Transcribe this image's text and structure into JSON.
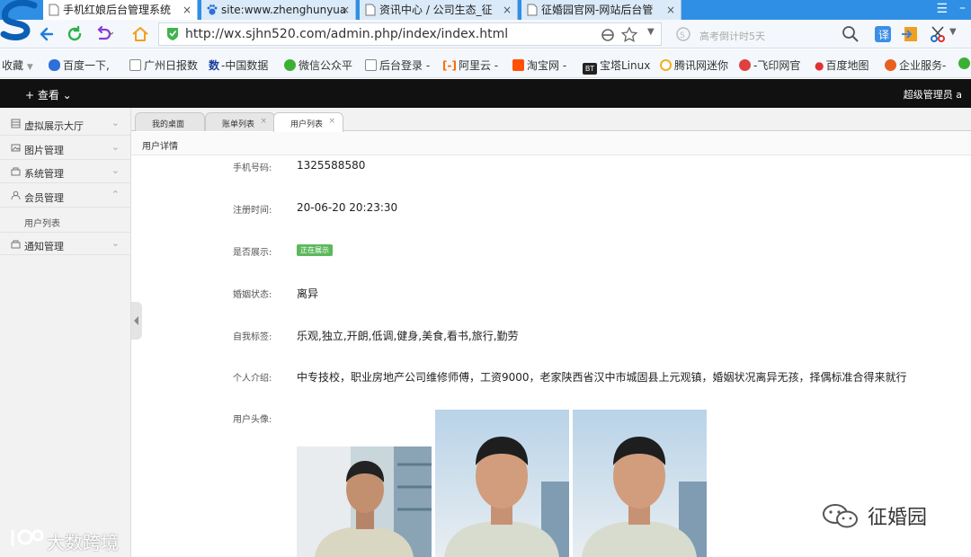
{
  "browser": {
    "tabs": [
      {
        "label": "手机红娘后台管理系统",
        "close": "×"
      },
      {
        "label": "site:www.zhenghunyua",
        "close": "×"
      },
      {
        "label": "资讯中心 / 公司生态_征",
        "close": "×"
      },
      {
        "label": "征婚园官网-网站后台管",
        "close": "×"
      }
    ],
    "url": "http://wx.sjhn520.com/admin.php/index/index.html",
    "search_placeholder": "高考倒计时5天",
    "bookmarks": [
      "收藏",
      "百度一下,",
      "广州日报数",
      "-中国数据",
      "微信公众平",
      "后台登录 -",
      "阿里云 -",
      "淘宝网 -",
      "宝塔Linux",
      "腾讯网迷你",
      "-飞印网官",
      "百度地图",
      "企业服务-"
    ]
  },
  "topbar": {
    "view_menu": "+ 查看 ⌄",
    "admin_user": "超级管理员 a"
  },
  "sidebar": {
    "items": [
      {
        "label": "虚拟展示大厅"
      },
      {
        "label": "图片管理"
      },
      {
        "label": "系统管理"
      },
      {
        "label": "会员管理"
      },
      {
        "label": "通知管理"
      }
    ],
    "sub_items": [
      {
        "label": "用户列表"
      }
    ]
  },
  "page_tabs": [
    {
      "label": "我的桌面"
    },
    {
      "label": "账单列表",
      "close": "×"
    },
    {
      "label": "用户列表",
      "close": "×"
    }
  ],
  "subheader": {
    "title": "用户详情"
  },
  "user": {
    "phone_label": "手机号码:",
    "phone": "1325588580",
    "reg_label": "注册时间:",
    "reg_time": "20-06-20 20:23:30",
    "show_label": "是否展示:",
    "show_status": "正在展示",
    "marital_label": "婚姻状态:",
    "marital": "离异",
    "tags_label": "自我标签:",
    "tags": "乐观,独立,开朗,低调,健身,美食,看书,旅行,勤劳",
    "intro_label": "个人介绍:",
    "intro": "中专技校，职业房地产公司维修师傅，工资9000，老家陕西省汉中市城固县上元观镇，婚姻状况离异无孩，择偶标准合得来就行",
    "avatar_label": "用户头像:"
  },
  "watermarks": {
    "left": "大数跨境",
    "right": "征婚园"
  },
  "colors": {
    "tabbar": "#2f8fe4",
    "topbar": "#111111",
    "badge": "#5cb85c"
  }
}
